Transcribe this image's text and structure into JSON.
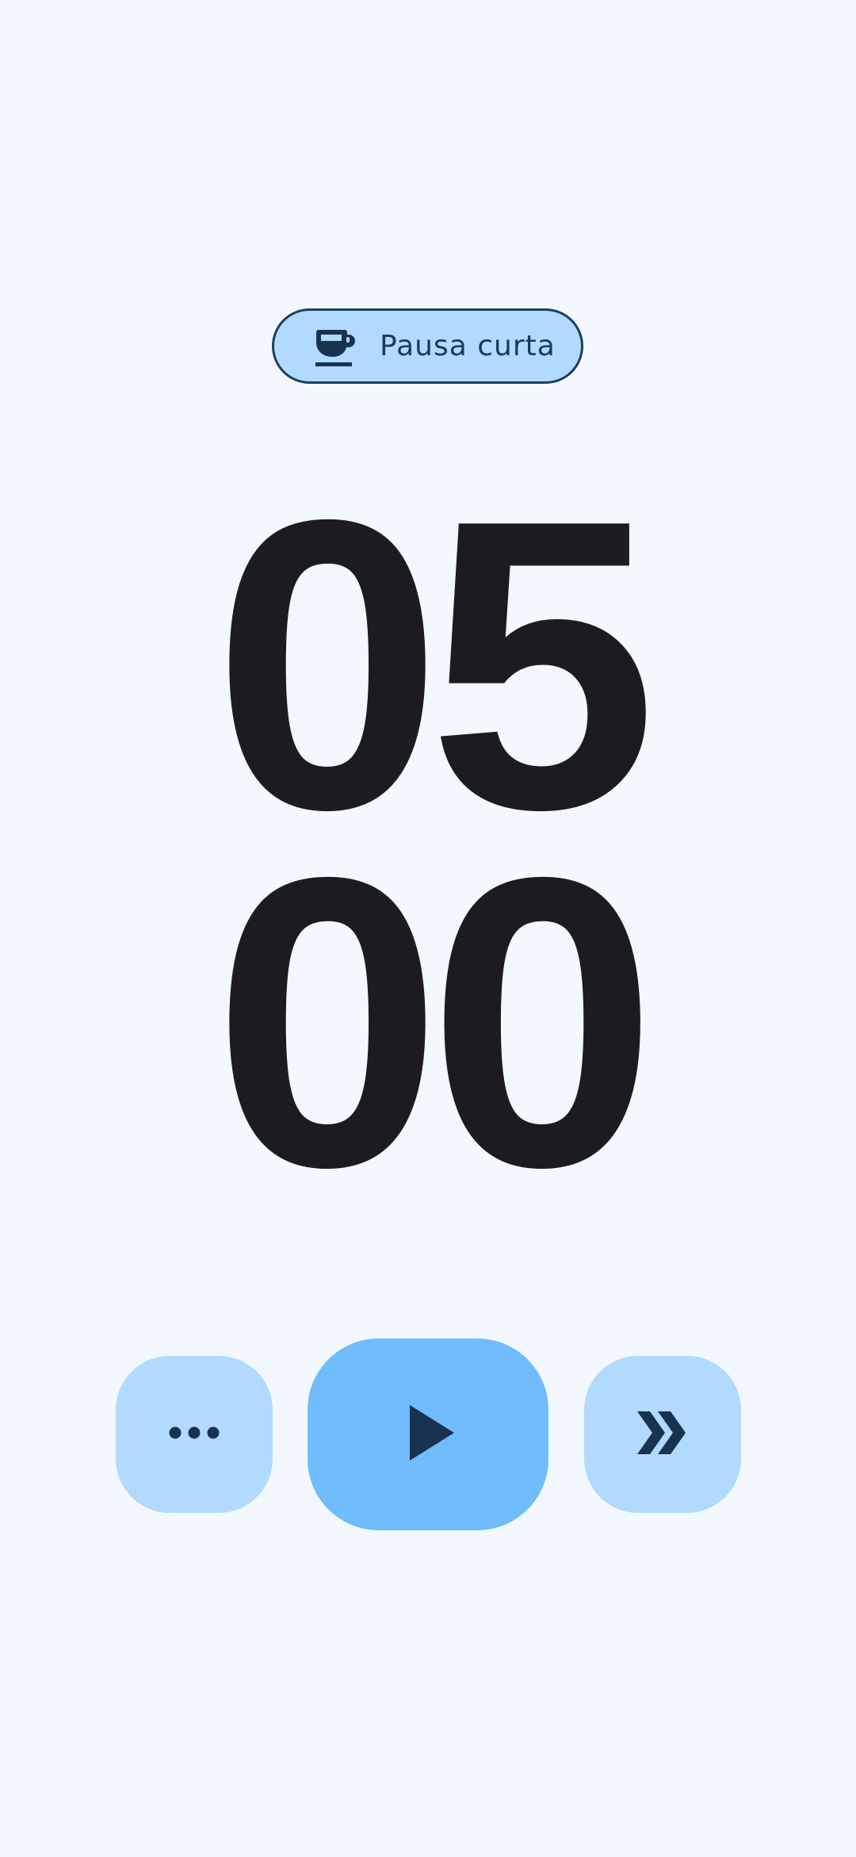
{
  "timer_mode": {
    "label": "Pausa curta",
    "icon": "coffee-cup-icon"
  },
  "timer": {
    "minutes": "05",
    "seconds": "00"
  },
  "controls": {
    "more_icon": "more-horizontal-icon",
    "play_icon": "play-icon",
    "skip_icon": "skip-next-icon"
  },
  "colors": {
    "background": "#f2f8fe",
    "chip_background": "#b1dafe",
    "chip_border": "#1d3e5c",
    "primary_button": "#70bcfd",
    "secondary_button": "#b1dafe",
    "icon": "#17334f",
    "digits": "#1c1c20"
  }
}
